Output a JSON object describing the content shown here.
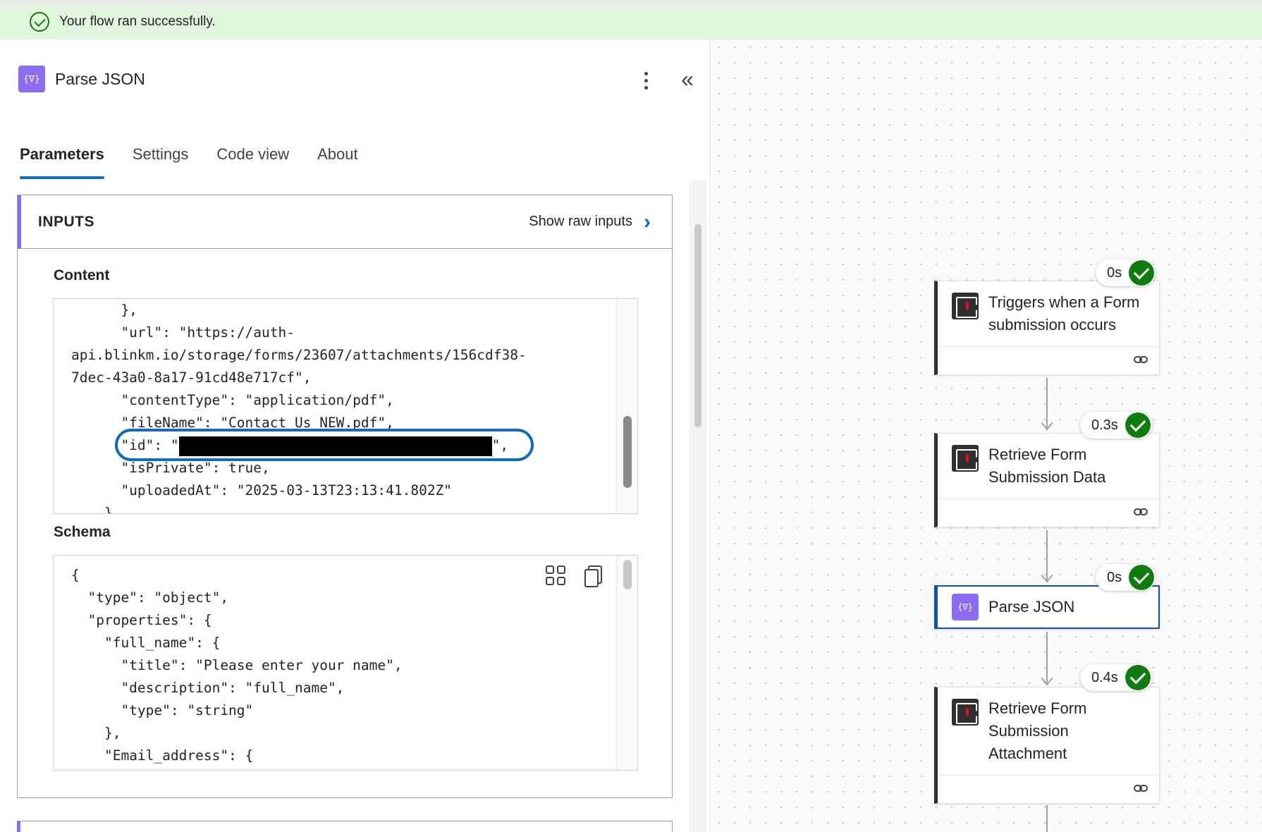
{
  "banner": {
    "text": "Your flow ran successfully."
  },
  "panel": {
    "title": "Parse JSON",
    "icon": "parse-json-icon",
    "tabs": [
      {
        "label": "Parameters",
        "active": true
      },
      {
        "label": "Settings",
        "active": false
      },
      {
        "label": "Code view",
        "active": false
      },
      {
        "label": "About",
        "active": false
      }
    ]
  },
  "inputs": {
    "title": "INPUTS",
    "raw_link": "Show raw inputs",
    "content_label": "Content",
    "content_lines": [
      "      },",
      "      \"url\": \"https://auth-",
      "api.blinkm.io/storage/forms/23607/attachments/156cdf38-",
      "7dec-43a0-8a17-91cd48e717cf\",",
      "      \"contentType\": \"application/pdf\",",
      "      \"fileName\": \"Contact Us NEW.pdf\",",
      "      \"id\": \"",
      "      \"isPrivate\": true,",
      "      \"uploadedAt\": \"2025-03-13T23:13:41.802Z\"",
      "    }"
    ],
    "id_line_suffix": "\",",
    "schema_label": "Schema",
    "schema_lines": [
      "{",
      "  \"type\": \"object\",",
      "  \"properties\": {",
      "    \"full_name\": {",
      "      \"title\": \"Please enter your name\",",
      "      \"description\": \"full_name\",",
      "      \"type\": \"string\"",
      "    },",
      "    \"Email_address\": {"
    ]
  },
  "flow": {
    "nodes": [
      {
        "title_lines": [
          "Triggers when a Form",
          "submission occurs"
        ],
        "duration": "0s",
        "status": "succeeded"
      },
      {
        "title_lines": [
          "Retrieve Form",
          "Submission Data"
        ],
        "duration": "0.3s",
        "status": "succeeded"
      },
      {
        "title_lines": [
          "Parse JSON"
        ],
        "duration": "0s",
        "status": "succeeded",
        "selected": true
      },
      {
        "title_lines": [
          "Retrieve Form",
          "Submission",
          "Attachment"
        ],
        "duration": "0.4s",
        "status": "succeeded"
      }
    ]
  },
  "colors": {
    "success": "#107c10",
    "accent": "#0f6cbd",
    "parse_json": "#8b6cf0",
    "banner_bg": "#dff6dd"
  }
}
